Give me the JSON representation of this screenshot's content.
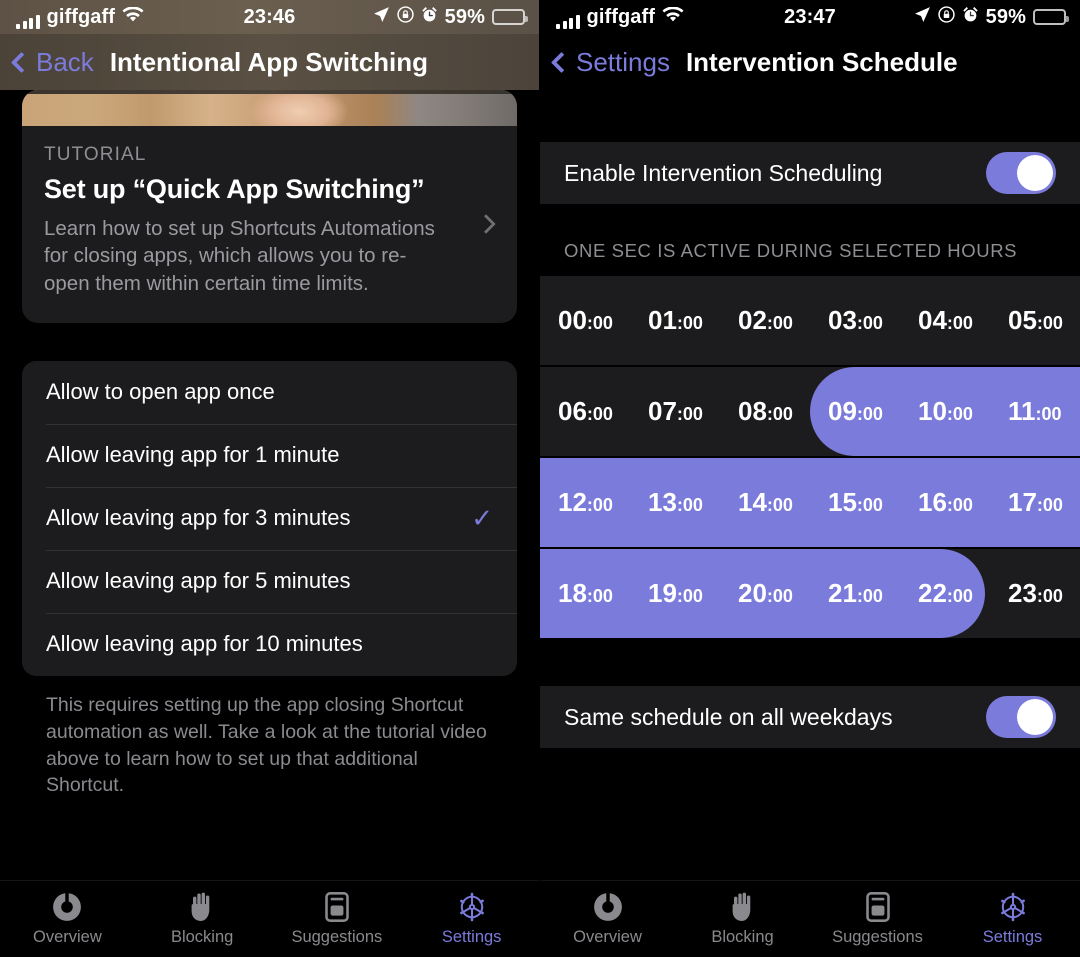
{
  "accent_color": "#7B7BDC",
  "background_color": "#000000",
  "card_color": "#1c1c1e",
  "left": {
    "statusbar": {
      "carrier": "giffgaff",
      "time": "23:46",
      "battery_percent": "59%",
      "icons": [
        "signal-bars-icon",
        "wifi-icon",
        "location-arrow-icon",
        "rotation-lock-icon",
        "alarm-clock-icon",
        "battery-low-power-icon"
      ]
    },
    "navbar": {
      "back_label": "Back",
      "title": "Intentional App Switching"
    },
    "tutorial_card": {
      "kicker": "TUTORIAL",
      "title": "Set up “Quick App Switching”",
      "description": "Learn how to set up Shortcuts Automations for closing apps, which allows you to re-open them within certain time limits."
    },
    "options": [
      {
        "label": "Allow to open app once",
        "selected": false
      },
      {
        "label": "Allow leaving app for 1 minute",
        "selected": false
      },
      {
        "label": "Allow leaving app for 3 minutes",
        "selected": true
      },
      {
        "label": "Allow leaving app for 5 minutes",
        "selected": false
      },
      {
        "label": "Allow leaving app for 10 minutes",
        "selected": false
      }
    ],
    "checkmark": "✓",
    "footnote": "This requires setting up the app closing Shortcut automation as well. Take a look at the tutorial video above to learn how to set up that additional Shortcut.",
    "tabs": [
      {
        "label": "Overview",
        "icon": "overview-ring-icon",
        "active": false
      },
      {
        "label": "Blocking",
        "icon": "hand-icon",
        "active": false
      },
      {
        "label": "Suggestions",
        "icon": "card-icon",
        "active": false
      },
      {
        "label": "Settings",
        "icon": "gear-icon",
        "active": true
      }
    ]
  },
  "right": {
    "statusbar": {
      "carrier": "giffgaff",
      "time": "23:47",
      "battery_percent": "59%",
      "icons": [
        "signal-bars-icon",
        "wifi-icon",
        "location-arrow-icon",
        "rotation-lock-icon",
        "alarm-clock-icon",
        "battery-low-power-icon"
      ]
    },
    "navbar": {
      "back_label": "Settings",
      "title": "Intervention Schedule"
    },
    "enable_row": {
      "label": "Enable Intervention Scheduling",
      "toggle_on": true
    },
    "section_header": "ONE SEC IS ACTIVE DURING SELECTED HOURS",
    "hour_rows": [
      {
        "cells": [
          {
            "hh": "00",
            "mm": ":00",
            "selected": false
          },
          {
            "hh": "01",
            "mm": ":00",
            "selected": false
          },
          {
            "hh": "02",
            "mm": ":00",
            "selected": false
          },
          {
            "hh": "03",
            "mm": ":00",
            "selected": false
          },
          {
            "hh": "04",
            "mm": ":00",
            "selected": false
          },
          {
            "hh": "05",
            "mm": ":00",
            "selected": false
          }
        ]
      },
      {
        "cells": [
          {
            "hh": "06",
            "mm": ":00",
            "selected": false
          },
          {
            "hh": "07",
            "mm": ":00",
            "selected": false
          },
          {
            "hh": "08",
            "mm": ":00",
            "selected": false
          },
          {
            "hh": "09",
            "mm": ":00",
            "selected": true
          },
          {
            "hh": "10",
            "mm": ":00",
            "selected": true
          },
          {
            "hh": "11",
            "mm": ":00",
            "selected": true
          }
        ]
      },
      {
        "cells": [
          {
            "hh": "12",
            "mm": ":00",
            "selected": true
          },
          {
            "hh": "13",
            "mm": ":00",
            "selected": true
          },
          {
            "hh": "14",
            "mm": ":00",
            "selected": true
          },
          {
            "hh": "15",
            "mm": ":00",
            "selected": true
          },
          {
            "hh": "16",
            "mm": ":00",
            "selected": true
          },
          {
            "hh": "17",
            "mm": ":00",
            "selected": true
          }
        ]
      },
      {
        "cells": [
          {
            "hh": "18",
            "mm": ":00",
            "selected": true
          },
          {
            "hh": "19",
            "mm": ":00",
            "selected": true
          },
          {
            "hh": "20",
            "mm": ":00",
            "selected": true
          },
          {
            "hh": "21",
            "mm": ":00",
            "selected": true
          },
          {
            "hh": "22",
            "mm": ":00",
            "selected": true
          },
          {
            "hh": "23",
            "mm": ":00",
            "selected": false
          }
        ]
      }
    ],
    "selected_range": {
      "start": "09:00",
      "end": "22:00"
    },
    "weekday_row": {
      "label": "Same schedule on all weekdays",
      "toggle_on": true
    },
    "tabs": [
      {
        "label": "Overview",
        "icon": "overview-ring-icon",
        "active": false
      },
      {
        "label": "Blocking",
        "icon": "hand-icon",
        "active": false
      },
      {
        "label": "Suggestions",
        "icon": "card-icon",
        "active": false
      },
      {
        "label": "Settings",
        "icon": "gear-icon",
        "active": true
      }
    ]
  }
}
